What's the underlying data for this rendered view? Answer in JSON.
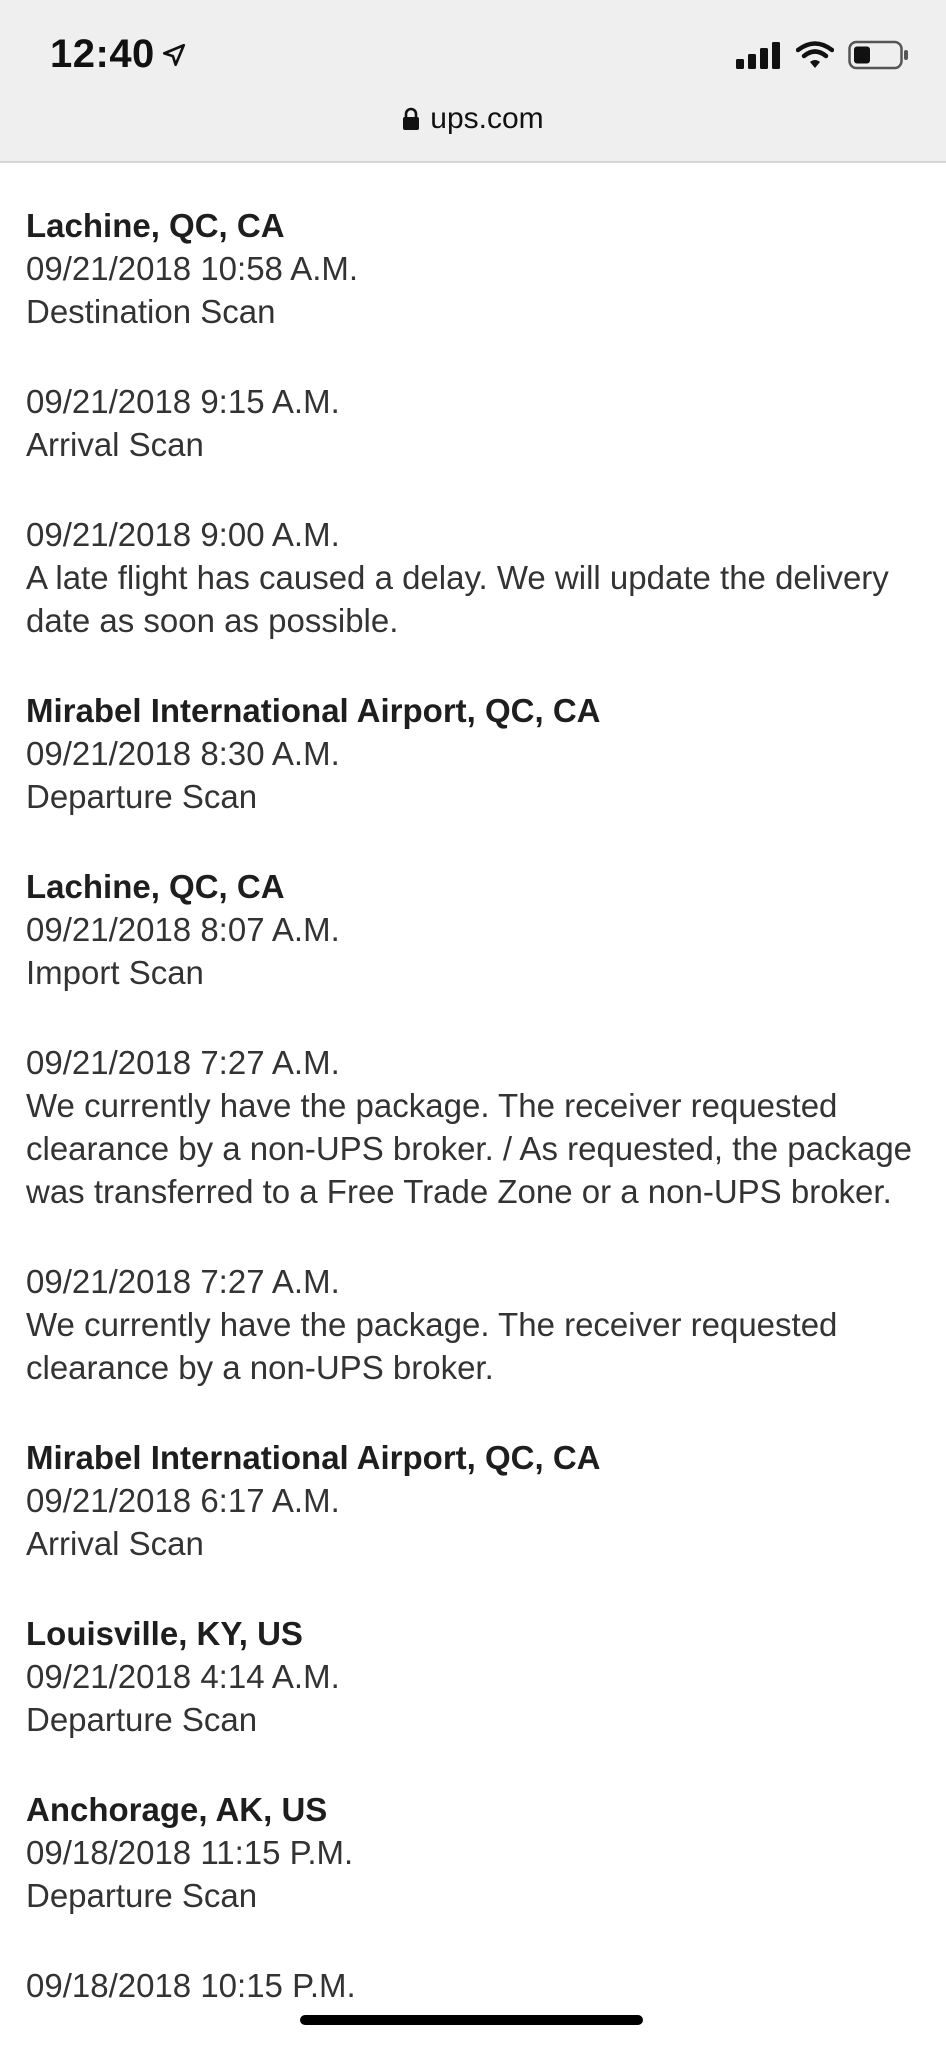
{
  "status_bar": {
    "time": "12:40",
    "icons": [
      "location-arrow-icon",
      "cellular-signal-icon",
      "wifi-icon",
      "battery-icon"
    ]
  },
  "url_bar": {
    "domain": "ups.com",
    "icon": "lock-icon"
  },
  "tracking_events": [
    {
      "location": "Lachine, QC, CA",
      "datetime": "09/21/2018 10:58 A.M.",
      "activity": "Destination Scan"
    },
    {
      "location": "",
      "datetime": "09/21/2018 9:15 A.M.",
      "activity": "Arrival Scan"
    },
    {
      "location": "",
      "datetime": "09/21/2018 9:00 A.M.",
      "activity": "A late flight has caused a delay. We will update the delivery date as soon as possible."
    },
    {
      "location": "Mirabel International Airport, QC, CA",
      "datetime": "09/21/2018 8:30 A.M.",
      "activity": "Departure Scan"
    },
    {
      "location": "Lachine, QC, CA",
      "datetime": "09/21/2018 8:07 A.M.",
      "activity": "Import Scan"
    },
    {
      "location": "",
      "datetime": "09/21/2018 7:27 A.M.",
      "activity": "We currently have the package. The receiver requested clearance by a non-UPS broker. / As requested, the package was transferred to a Free Trade Zone or a non-UPS broker."
    },
    {
      "location": "",
      "datetime": "09/21/2018 7:27 A.M.",
      "activity": "We currently have the package. The receiver requested clearance by a non-UPS broker."
    },
    {
      "location": "Mirabel International Airport, QC, CA",
      "datetime": "09/21/2018 6:17 A.M.",
      "activity": "Arrival Scan"
    },
    {
      "location": "Louisville, KY, US",
      "datetime": "09/21/2018 4:14 A.M.",
      "activity": "Departure Scan"
    },
    {
      "location": "Anchorage, AK, US",
      "datetime": "09/18/2018 11:15 P.M.",
      "activity": "Departure Scan"
    },
    {
      "location": "",
      "datetime": "09/18/2018 10:15 P.M.",
      "activity": ""
    }
  ]
}
